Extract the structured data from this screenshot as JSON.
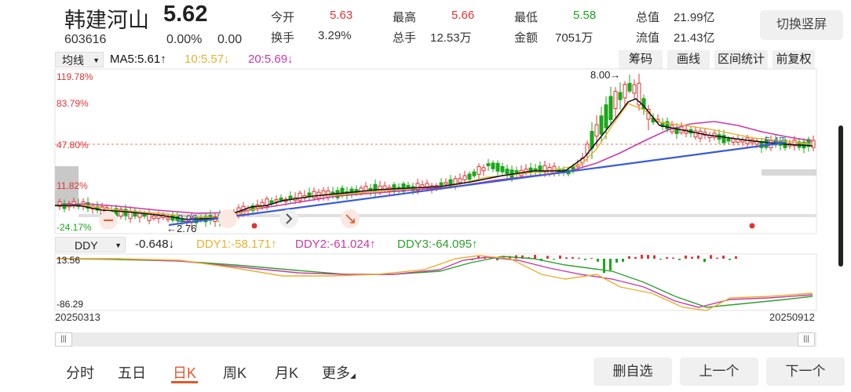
{
  "stock": {
    "name": "韩建河山",
    "price": "5.62",
    "code": "603616",
    "change_pct": "0.00%",
    "change": "0.00"
  },
  "quote": {
    "open_label": "今开",
    "open": "5.63",
    "high_label": "最高",
    "high": "5.66",
    "low_label": "最低",
    "low": "5.58",
    "mktcap_label": "总值",
    "mktcap": "21.99亿",
    "turnover_label": "换手",
    "turnover": "3.29%",
    "volume_label": "总手",
    "volume": "12.53万",
    "amount_label": "金额",
    "amount": "7051万",
    "float_label": "流值",
    "float": "21.43亿"
  },
  "switch_button": "切换竖屏",
  "toolbar": {
    "indicator_select": "均线",
    "ma5": "MA5:5.61↑",
    "ma10": "10:5.57↓",
    "ma20": "20:5.69↓",
    "chip": "筹码",
    "draw": "画线",
    "range": "区间统计",
    "adjust": "前复权"
  },
  "main_axis": {
    "y1": "119.78%",
    "y2": "83.79%",
    "y3": "47.80%",
    "y4": "11.82%",
    "y5": "-24.17%"
  },
  "annotations": {
    "high_mark": "8.00→",
    "low_mark": "←2.76",
    "low_mark2": "2.96",
    "trend_end": "5.47"
  },
  "indicator": {
    "name": "DDY",
    "ddy": "-0.648↓",
    "ddy1": "DDY1:-58.171↑",
    "ddy2": "DDY2:-61.024↑",
    "ddy3": "DDY3:-64.095↑",
    "y_top": "13.56",
    "y_bottom": "-86.29"
  },
  "dates": {
    "start": "20250313",
    "end": "20250912"
  },
  "tabs": [
    "分时",
    "五日",
    "日K",
    "周K",
    "月K",
    "更多"
  ],
  "bottom_buttons": {
    "delete": "删自选",
    "prev": "上一个",
    "next": "下一个"
  },
  "colors": {
    "up": "#e03434",
    "down": "#1aa61a",
    "ma5": "#111111",
    "ma10": "#e8b030",
    "ma20": "#c83aa8",
    "trend": "#3a5ad8",
    "accent": "#e0582a"
  }
}
